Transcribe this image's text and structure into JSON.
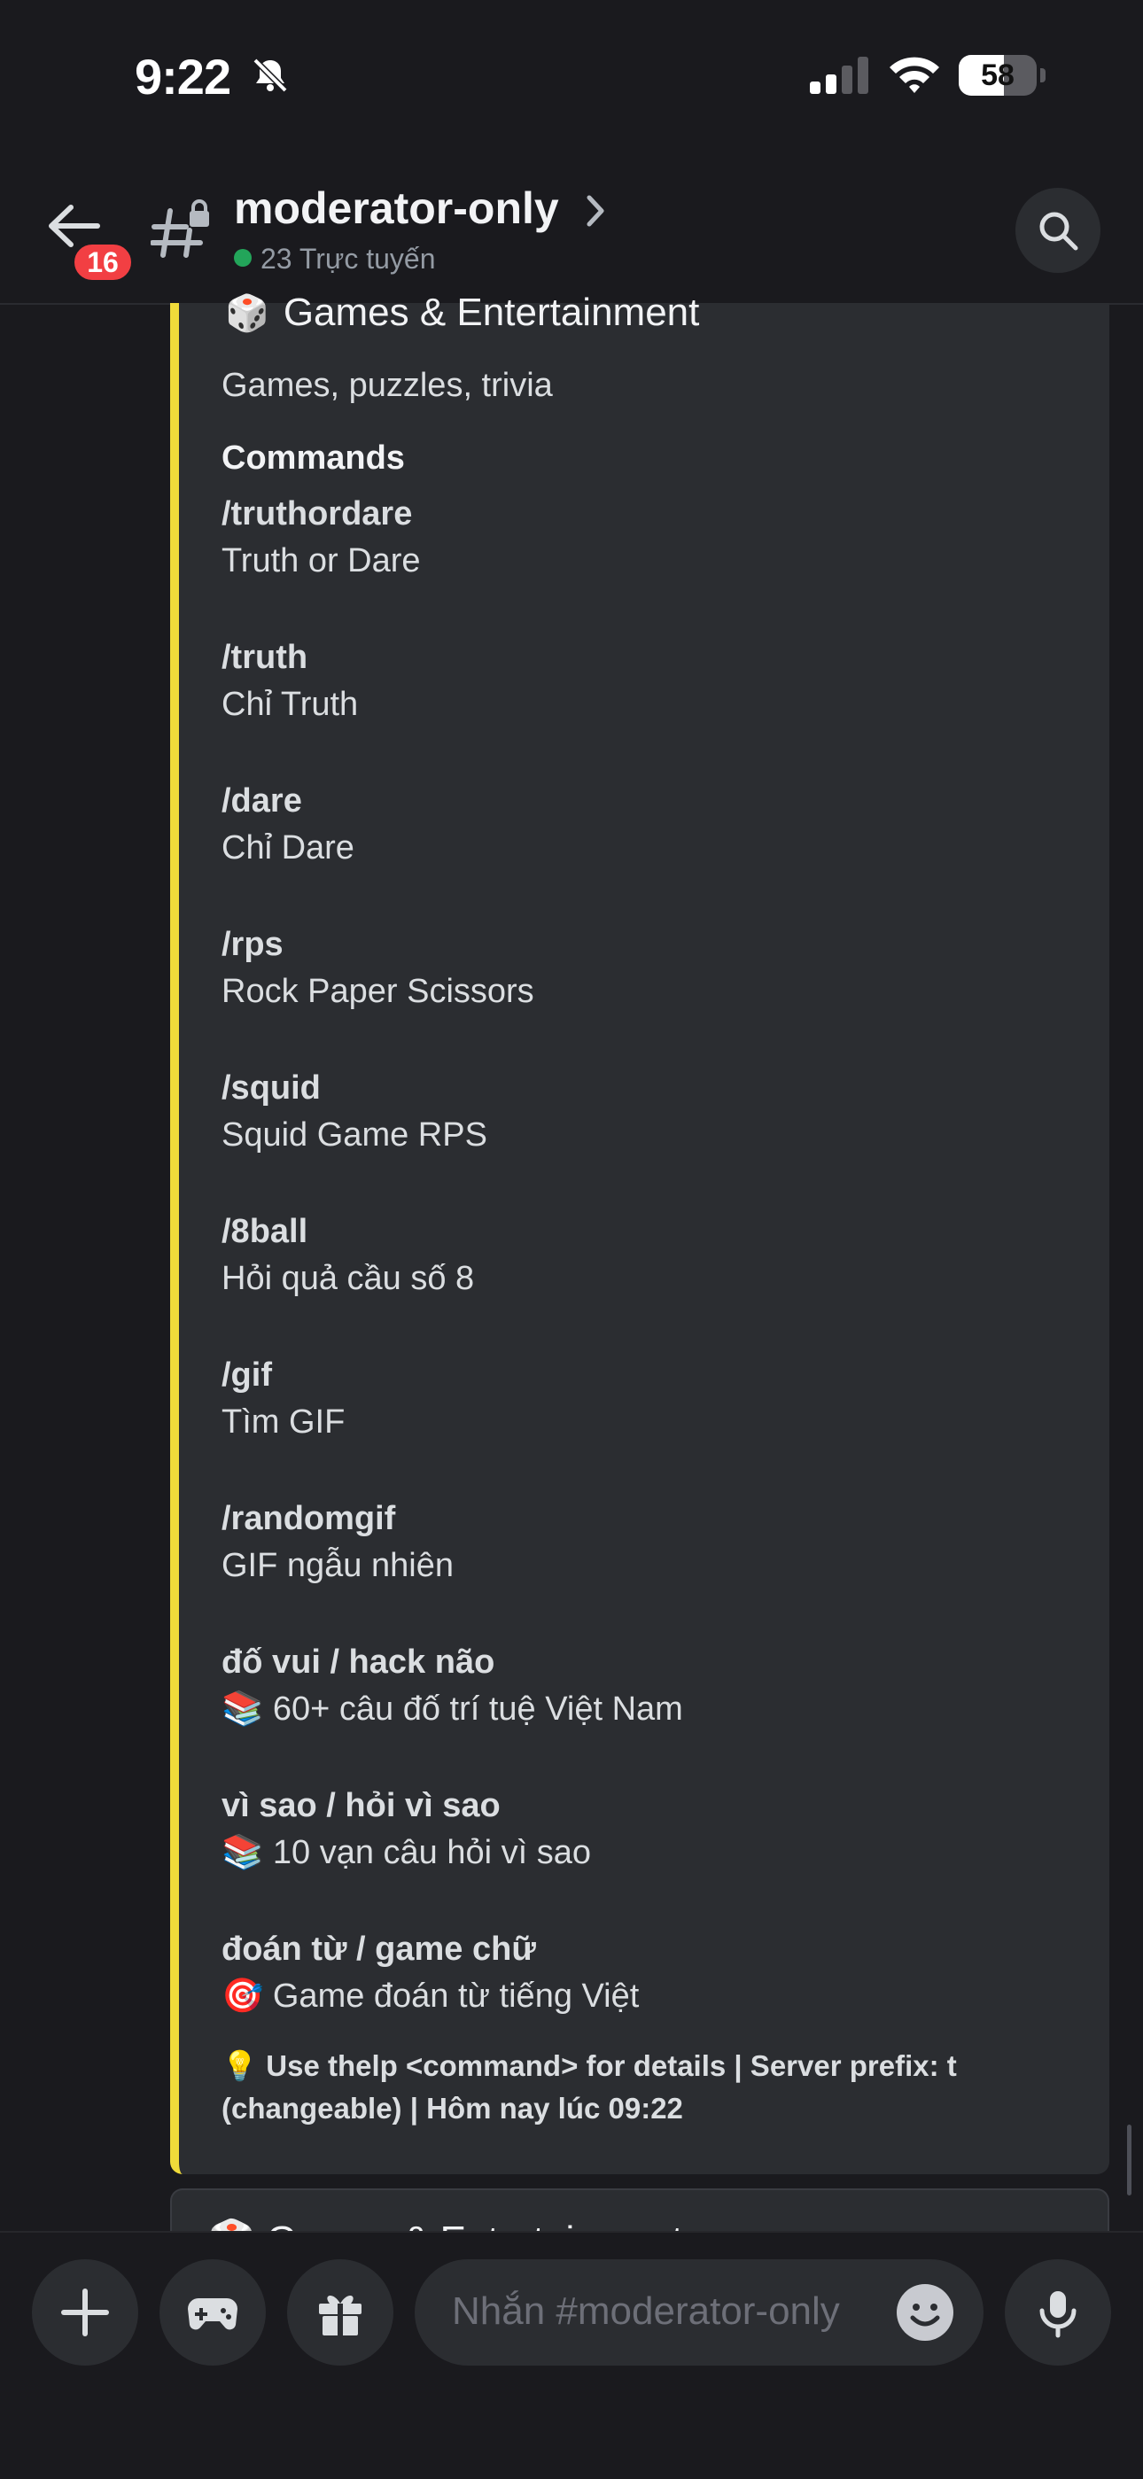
{
  "status_bar": {
    "time": "9:22",
    "battery_level": "58",
    "battery_fraction": 0.58
  },
  "header": {
    "unread_badge": "16",
    "channel_name": "moderator-only",
    "online_text": "23 Trực tuyến"
  },
  "embed": {
    "title_emoji": "🎲",
    "title": "Games & Entertainment",
    "description": "Games, puzzles, trivia",
    "field_name": "Commands",
    "accent_color": "#f0db3a",
    "commands": [
      {
        "name": "/truthordare",
        "desc": "Truth or Dare"
      },
      {
        "name": "/truth",
        "desc": "Chỉ Truth"
      },
      {
        "name": "/dare",
        "desc": "Chỉ Dare"
      },
      {
        "name": "/rps",
        "desc": "Rock Paper Scissors"
      },
      {
        "name": "/squid",
        "desc": "Squid Game RPS"
      },
      {
        "name": "/8ball",
        "desc": "Hỏi quả cầu số 8"
      },
      {
        "name": "/gif",
        "desc": "Tìm GIF"
      },
      {
        "name": "/randomgif",
        "desc": "GIF ngẫu nhiên"
      },
      {
        "name": "đố vui / hack não",
        "desc": "📚 60+ câu đố trí tuệ Việt Nam"
      },
      {
        "name": "vì sao / hỏi vì sao",
        "desc": "📚 10 vạn câu hỏi vì sao"
      },
      {
        "name": "đoán từ / game chữ",
        "desc": "🎯 Game đoán từ tiếng Việt"
      }
    ],
    "footer": "💡 Use thelp <command> for details | Server prefix: t (changeable) | Hôm nay lúc 09:22"
  },
  "next_embed": {
    "title": "🎲 Games & Entertainment"
  },
  "composer": {
    "placeholder": "Nhắn #moderator-only"
  }
}
